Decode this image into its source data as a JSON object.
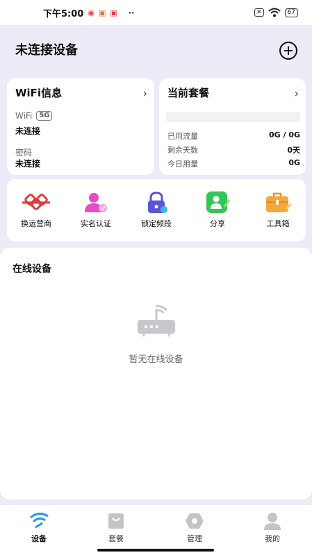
{
  "status_bar": {
    "time": "下午5:00",
    "battery": "67",
    "icons": [
      "eye-icon",
      "notification-icon",
      "app-icon",
      "more-dots-icon",
      "sim-x-icon",
      "wifi-icon",
      "battery-icon"
    ]
  },
  "header": {
    "title": "未连接设备",
    "action_icon": "add-circle-icon"
  },
  "wifi_card": {
    "title": "WiFi信息",
    "ssid_label": "WiFi",
    "band_badge": "5G",
    "ssid_value": "未连接",
    "password_label": "密码",
    "password_value": "未连接"
  },
  "plan_card": {
    "title": "当前套餐",
    "rows": [
      {
        "label": "已用流量",
        "value": "0G / 0G"
      },
      {
        "label": "剩余天数",
        "value": "0天"
      },
      {
        "label": "今日用量",
        "value": "0G"
      }
    ]
  },
  "tools": [
    {
      "label": "换运营商",
      "icon": "knot-icon",
      "color": "#e03b3b"
    },
    {
      "label": "实名认证",
      "icon": "user-verify-icon",
      "color": "#e84bc6"
    },
    {
      "label": "锁定频段",
      "icon": "lock-icon",
      "color": "#5b54d6"
    },
    {
      "label": "分享",
      "icon": "share-icon",
      "color": "#35c45a"
    },
    {
      "label": "工具箱",
      "icon": "toolbox-icon",
      "color": "#f2a93b"
    }
  ],
  "online": {
    "title": "在线设备",
    "empty_text": "暂无在线设备",
    "empty_icon": "router-icon"
  },
  "tabs": [
    {
      "label": "设备",
      "icon": "device-signal-icon",
      "active": true
    },
    {
      "label": "套餐",
      "icon": "shopping-bag-icon",
      "active": false
    },
    {
      "label": "管理",
      "icon": "hexagon-icon",
      "active": false
    },
    {
      "label": "我的",
      "icon": "person-icon",
      "active": false
    }
  ],
  "colors": {
    "background": "#ecebf7",
    "card": "#ffffff",
    "active_tab": "#2196f3"
  }
}
